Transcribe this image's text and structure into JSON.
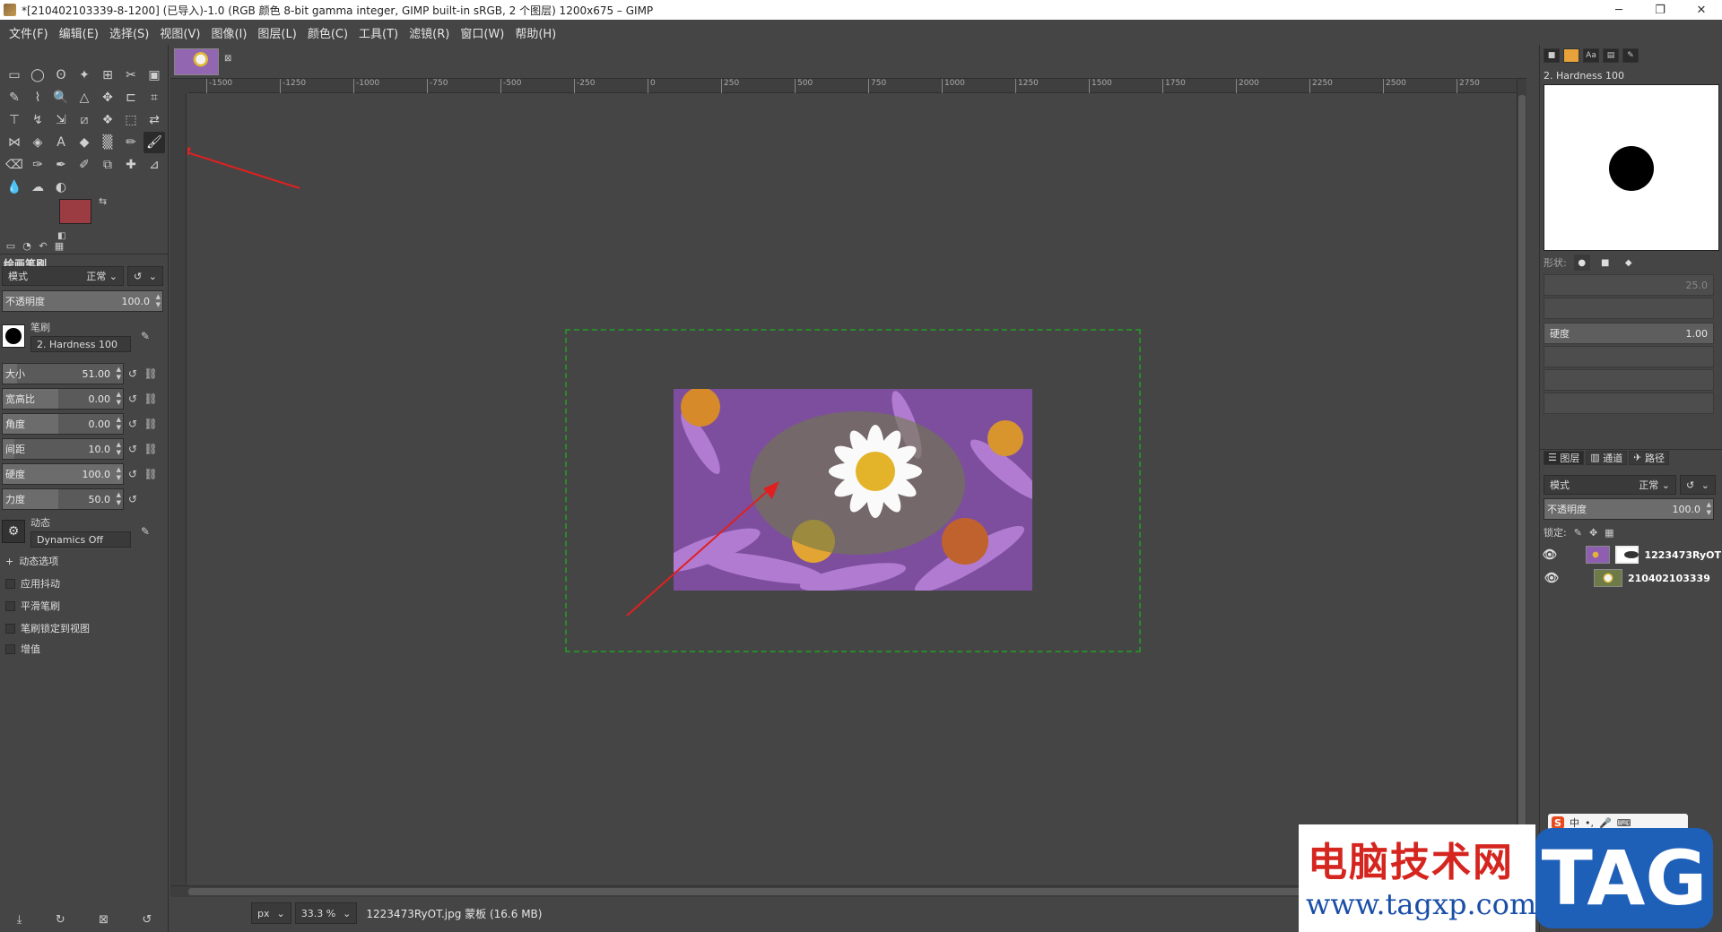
{
  "window": {
    "title": "*[210402103339-8-1200] (已导入)-1.0 (RGB 颜色 8-bit gamma integer, GIMP built-in sRGB, 2 个图层) 1200x675 – GIMP",
    "minimize": "─",
    "maximize": "❐",
    "close": "✕"
  },
  "menu": [
    "文件(F)",
    "编辑(E)",
    "选择(S)",
    "视图(V)",
    "图像(I)",
    "图层(L)",
    "颜色(C)",
    "工具(T)",
    "滤镜(R)",
    "窗口(W)",
    "帮助(H)"
  ],
  "colors": {
    "foreground": "#9b3b42",
    "background": "#ffffff",
    "selection_border": "#2a8a2a",
    "annotation_arrow": "#e02020"
  },
  "tools": [
    {
      "name": "rect-select",
      "glyph": "▭"
    },
    {
      "name": "ellipse-select",
      "glyph": "◯"
    },
    {
      "name": "free-select",
      "glyph": "ʘ"
    },
    {
      "name": "fuzzy-select",
      "glyph": "✦"
    },
    {
      "name": "select-by-color",
      "glyph": "⊞"
    },
    {
      "name": "scissors-select",
      "glyph": "✂"
    },
    {
      "name": "foreground-select",
      "glyph": "▣"
    },
    {
      "name": "paths",
      "glyph": "✎"
    },
    {
      "name": "color-picker",
      "glyph": "⌇"
    },
    {
      "name": "zoom",
      "glyph": "🔍"
    },
    {
      "name": "measure",
      "glyph": "△"
    },
    {
      "name": "move",
      "glyph": "✥"
    },
    {
      "name": "align",
      "glyph": "⊏"
    },
    {
      "name": "crop",
      "glyph": "⌗"
    },
    {
      "name": "unified-transform",
      "glyph": "⊤"
    },
    {
      "name": "warp",
      "glyph": "↯"
    },
    {
      "name": "handle-transform",
      "glyph": "⇲"
    },
    {
      "name": "shear",
      "glyph": "⧄"
    },
    {
      "name": "cage",
      "glyph": "❖"
    },
    {
      "name": "perspective",
      "glyph": "⬚"
    },
    {
      "name": "flip",
      "glyph": "⇄"
    },
    {
      "name": "gegl",
      "glyph": "⋈"
    },
    {
      "name": "bucket",
      "glyph": "◈"
    },
    {
      "name": "text",
      "glyph": "A"
    },
    {
      "name": "fill",
      "glyph": "◆"
    },
    {
      "name": "gradient",
      "glyph": "▒"
    },
    {
      "name": "pencil",
      "glyph": "✏"
    },
    {
      "name": "paintbrush",
      "glyph": "🖌"
    },
    {
      "name": "eraser",
      "glyph": "⌫"
    },
    {
      "name": "airbrush",
      "glyph": "✑"
    },
    {
      "name": "ink",
      "glyph": "✒"
    },
    {
      "name": "mypaint",
      "glyph": "✐"
    },
    {
      "name": "clone",
      "glyph": "⧉"
    },
    {
      "name": "heal",
      "glyph": "✚"
    },
    {
      "name": "perspective-clone",
      "glyph": "⊿"
    },
    {
      "name": "blur",
      "glyph": "💧"
    },
    {
      "name": "smudge",
      "glyph": "☁"
    },
    {
      "name": "dodge",
      "glyph": "◐"
    }
  ],
  "tool_options": {
    "title": "绘画笔刷",
    "mode_label": "模式",
    "mode_value": "正常",
    "opacity_label": "不透明度",
    "opacity_value": "100.0",
    "brush_label": "笔刷",
    "brush_value": "2. Hardness 100",
    "size_label": "大小",
    "size_value": "51.00",
    "aspect_label": "宽高比",
    "aspect_value": "0.00",
    "angle_label": "角度",
    "angle_value": "0.00",
    "spacing_label": "间距",
    "spacing_value": "10.0",
    "hardness_label": "硬度",
    "hardness_value": "100.0",
    "force_label": "力度",
    "force_value": "50.0",
    "dynamics_label": "动态",
    "dynamics_value": "Dynamics Off",
    "dynamics_options": "动态选项",
    "apply_jitter": "应用抖动",
    "smooth_stroke": "平滑笔刷",
    "lock_brush": "笔刷锁定到视图",
    "incremental": "增值"
  },
  "ruler_ticks": [
    "-1500",
    "-1250",
    "-1000",
    "-750",
    "-500",
    "-250",
    "0",
    "250",
    "500",
    "750",
    "1000",
    "1250",
    "1500",
    "1750",
    "2000",
    "2250",
    "2500",
    "2750"
  ],
  "status": {
    "unit": "px",
    "zoom": "33.3 %",
    "message": "1223473RyOT.jpg 蒙板 (16.6 MB)"
  },
  "brush_panel": {
    "brush_name": "2. Hardness 100",
    "shape_label": "形状:",
    "radius_value": "25.0",
    "hardness_label": "硬度",
    "hardness_value": "1.00"
  },
  "layers_panel": {
    "tab_layers": "图层",
    "tab_channels": "通道",
    "tab_paths": "路径",
    "mode_label": "模式",
    "mode_value": "正常",
    "opacity_label": "不透明度",
    "opacity_value": "100.0",
    "lock_label": "锁定:",
    "layers": [
      {
        "name": "1223473RyOT",
        "has_mask": true
      },
      {
        "name": "210402103339",
        "has_mask": false
      }
    ]
  },
  "watermark": {
    "cn_text": "电脑技术网",
    "url": "www.tagxp.com",
    "tag": "TAG"
  },
  "ime": {
    "logo": "S",
    "label": "中"
  }
}
